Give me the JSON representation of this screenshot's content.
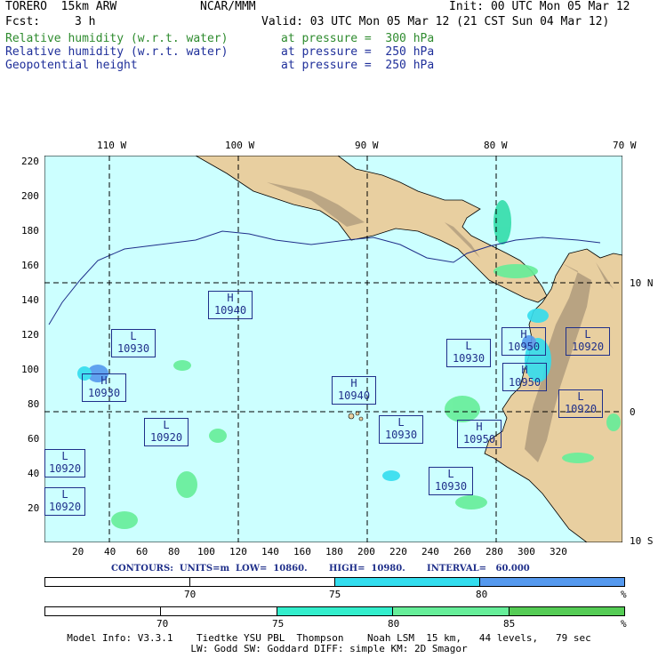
{
  "header": {
    "model": "TORERO  15km ARW",
    "org": "NCAR/MMM",
    "init": "Init: 00 UTC Mon 05 Mar 12",
    "fcst_label": "Fcst:",
    "fcst_value": "3 h",
    "valid": "Valid: 03 UTC Mon 05 Mar 12 (21 CST Sun 04 Mar 12)",
    "fields": [
      {
        "name": "Relative humidity (w.r.t. water)",
        "level": "at pressure =  300 hPa",
        "color": "#2e8b2e"
      },
      {
        "name": "Relative humidity (w.r.t. water)",
        "level": "at pressure =  250 hPa",
        "color": "#1f2f9a"
      },
      {
        "name": "Geopotential height",
        "level": "at pressure =  250 hPa",
        "color": "#1f2f9a"
      }
    ]
  },
  "map": {
    "top_lon_labels": [
      "110 W",
      "100 W",
      "90 W",
      "80 W",
      "70 W"
    ],
    "right_lat_labels": [
      "10 N",
      "0",
      "10 S"
    ],
    "left_y_ticks": [
      "220",
      "200",
      "180",
      "160",
      "140",
      "120",
      "100",
      "80",
      "60",
      "40",
      "20"
    ],
    "bottom_x_ticks": [
      "20",
      "40",
      "60",
      "80",
      "100",
      "120",
      "140",
      "160",
      "180",
      "200",
      "220",
      "240",
      "260",
      "280",
      "300",
      "320"
    ],
    "ocean_color": "#ccffff",
    "land_color": "#e8cfa0",
    "height_labels": [
      {
        "type": "H",
        "value": "10940"
      },
      {
        "type": "L",
        "value": "10930"
      },
      {
        "type": "H",
        "value": "10930"
      },
      {
        "type": "L",
        "value": "10920"
      },
      {
        "type": "L",
        "value": "10920"
      },
      {
        "type": "L",
        "value": "10920"
      },
      {
        "type": "H",
        "value": "10940"
      },
      {
        "type": "L",
        "value": "10930"
      },
      {
        "type": "L",
        "value": "10930"
      },
      {
        "type": "H",
        "value": "10950"
      },
      {
        "type": "H",
        "value": "10950"
      },
      {
        "type": "H",
        "value": "10950"
      },
      {
        "type": "L",
        "value": "10920"
      },
      {
        "type": "L",
        "value": "10920"
      },
      {
        "type": "L",
        "value": "10930"
      }
    ]
  },
  "contours_text": "CONTOURS:  UNITS=m  LOW=  10860.       HIGH=  10980.       INTERVAL=   60.000",
  "colorbar_250": {
    "labels": [
      "70",
      "75",
      "80",
      "%"
    ],
    "colors": [
      "#ffffff",
      "#ffffff",
      "#33ddee",
      "#33ddee",
      "#5599ee"
    ]
  },
  "colorbar_300": {
    "labels": [
      "70",
      "75",
      "80",
      "85",
      "%"
    ],
    "colors": [
      "#ffffff",
      "#ffffff",
      "#33eecc",
      "#66ee99",
      "#55cc55"
    ]
  },
  "footer": {
    "line1": "Model Info: V3.3.1    Tiedtke YSU PBL  Thompson    Noah LSM  15 km,   44 levels,   79 sec",
    "line2": "LW: Godd SW: Goddard DIFF: simple KM: 2D Smagor"
  }
}
